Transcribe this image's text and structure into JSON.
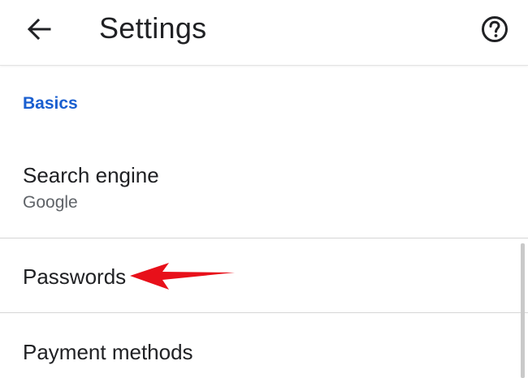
{
  "header": {
    "title": "Settings",
    "back_icon": "arrow-back-icon",
    "help_icon": "help-circle-icon"
  },
  "section": {
    "label": "Basics",
    "color": "#1a5fd0"
  },
  "items": [
    {
      "title": "Search engine",
      "subtitle": "Google"
    },
    {
      "title": "Passwords",
      "subtitle": ""
    },
    {
      "title": "Payment methods",
      "subtitle": ""
    }
  ],
  "annotation": {
    "type": "arrow",
    "color": "#e8101a",
    "points_to": "Passwords"
  }
}
